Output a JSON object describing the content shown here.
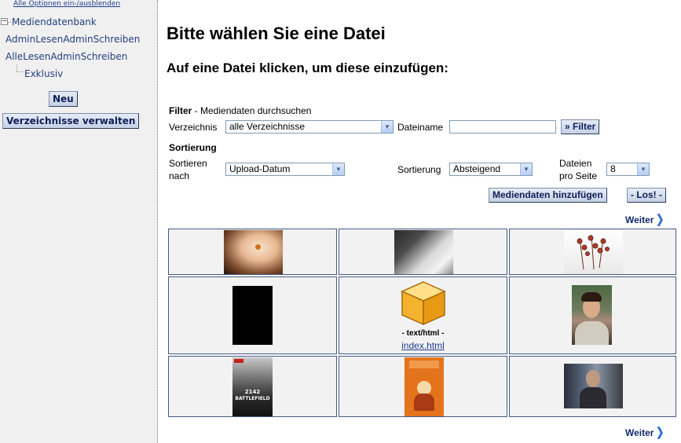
{
  "sidebar": {
    "toggle_link": "Alle Optionen ein-/ausblenden",
    "tree": {
      "root": "Mediendatenbank",
      "items": [
        "AdminLesenAdminSchreiben",
        "AlleLesenAdminSchreiben"
      ],
      "sub_items": [
        "Exklusiv"
      ]
    },
    "new_button": "Neu",
    "manage_button": "Verzeichnisse verwalten"
  },
  "main": {
    "title": "Bitte wählen Sie eine Datei",
    "subtitle": "Auf eine Datei klicken, um diese einzufügen:",
    "filter": {
      "heading": "Filter",
      "heading_suffix": " - Mediendaten durchsuchen",
      "directory_label": "Verzeichnis",
      "directory_value": "alle Verzeichnisse",
      "filename_label": "Dateiname",
      "filename_value": "",
      "filter_button": "» Filter"
    },
    "sort": {
      "heading": "Sortierung",
      "sort_by_label_1": "Sortieren",
      "sort_by_label_2": "nach",
      "sort_by_value": "Upload-Datum",
      "order_label": "Sortierung",
      "order_value": "Absteigend",
      "per_page_label_1": "Dateien",
      "per_page_label_2": "pro Seite",
      "per_page_value": "8"
    },
    "add_media_button": "Mediendaten hinzufügen",
    "go_button": "- Los! -",
    "next_top": "Weiter",
    "next_bottom": "Weiter",
    "files": [
      {
        "kind": "photo-hand-amber"
      },
      {
        "kind": "photo-hand-desk"
      },
      {
        "kind": "photo-dried-flowers"
      },
      {
        "kind": "black-image"
      },
      {
        "kind": "html-file",
        "type_label": "- text/html -",
        "name": "index.html"
      },
      {
        "kind": "photo-portrait"
      },
      {
        "kind": "game-cover-battlefield",
        "cover_text": "BATTLEFIELD",
        "cover_number": "2142"
      },
      {
        "kind": "book-cover-orange"
      },
      {
        "kind": "photo-person-computer"
      }
    ]
  },
  "colors": {
    "sidebar_bg": "#f0f0f0",
    "link": "#23407f",
    "button_text": "#0d1f55",
    "cell_border": "#425a86",
    "cell_bg": "#f2f2f2",
    "chevron": "#2b6fd6"
  }
}
